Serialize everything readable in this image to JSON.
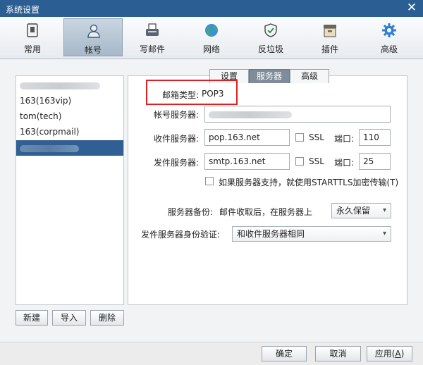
{
  "window": {
    "title": "系统设置",
    "close_glyph": "✕"
  },
  "toolbar": {
    "items": [
      {
        "label": "常用",
        "icon": "common-icon"
      },
      {
        "label": "帐号",
        "icon": "account-icon"
      },
      {
        "label": "写邮件",
        "icon": "compose-icon"
      },
      {
        "label": "网络",
        "icon": "network-icon"
      },
      {
        "label": "反垃圾",
        "icon": "antispam-icon"
      },
      {
        "label": "插件",
        "icon": "plugin-icon"
      },
      {
        "label": "高级",
        "icon": "advanced-icon"
      }
    ],
    "active_index": 1
  },
  "accounts": {
    "items": [
      "163(163vip)",
      "tom(tech)",
      "163(corpmail)"
    ],
    "buttons": {
      "new": "新建",
      "import": "导入",
      "delete": "删除"
    }
  },
  "tabs": {
    "items": [
      "设置",
      "服务器",
      "高级"
    ],
    "active_index": 1
  },
  "server": {
    "mailbox_type_label": "邮箱类型:",
    "mailbox_type_value": "POP3",
    "account_server_label": "帐号服务器:",
    "incoming_label": "收件服务器:",
    "incoming_value": "pop.163.net",
    "outgoing_label": "发件服务器:",
    "outgoing_value": "smtp.163.net",
    "ssl_label": "SSL",
    "port_label": "端口:",
    "incoming_port": "110",
    "outgoing_port": "25",
    "starttls_label": "如果服务器支持，就使用STARTTLS加密传输(T)",
    "backup_label": "服务器备份:",
    "backup_desc": "邮件收取后，在服务器上",
    "backup_option": "永久保留",
    "auth_label": "发件服务器身份验证:",
    "auth_option": "和收件服务器相同"
  },
  "footer": {
    "ok": "确定",
    "cancel": "取消",
    "apply": "应用(",
    "apply_key": "A",
    "apply_close": ")"
  },
  "colors": {
    "titlebar": "#2b5e92",
    "selected_account": "#2f5f93",
    "highlight": "#e02020"
  }
}
